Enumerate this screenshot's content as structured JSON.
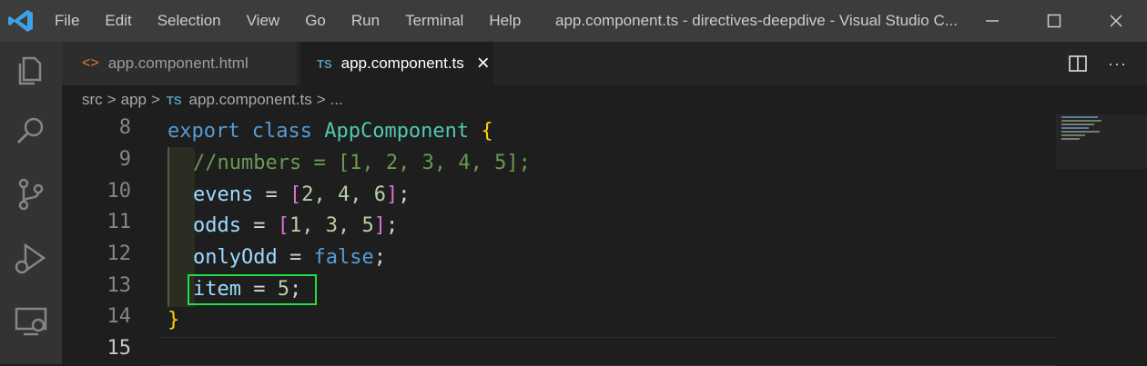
{
  "titlebar": {
    "menu": [
      "File",
      "Edit",
      "Selection",
      "View",
      "Go",
      "Run",
      "Terminal",
      "Help"
    ],
    "window_title": "app.component.ts - directives-deepdive - Visual Studio C..."
  },
  "tabs": [
    {
      "label": "app.component.html",
      "icon": "<>",
      "active": false
    },
    {
      "label": "app.component.ts",
      "icon": "TS",
      "active": true,
      "close": "×"
    }
  ],
  "tab_actions": {
    "more": "···"
  },
  "breadcrumb": {
    "items": [
      "src",
      "app",
      "app.component.ts",
      "..."
    ],
    "ts_badge": "TS",
    "separator": ">"
  },
  "editor": {
    "line_numbers": [
      "8",
      "9",
      "10",
      "11",
      "12",
      "13",
      "14",
      "15"
    ],
    "lines": {
      "l8": {
        "kw1": "export",
        "kw2": "class",
        "name": "AppComponent",
        "brace": "{"
      },
      "l9": {
        "comment": "//numbers = [1, 2, 3, 4, 5];"
      },
      "l10": {
        "var": "evens",
        "eq": " = ",
        "open": "[",
        "vals": "2, 4, 6",
        "close": "]",
        "semi": ";"
      },
      "l11": {
        "var": "odds",
        "eq": " = ",
        "open": "[",
        "vals": "1, 3, 5",
        "close": "]",
        "semi": ";"
      },
      "l12": {
        "var": "onlyOdd",
        "eq": " = ",
        "val": "false",
        "semi": ";"
      },
      "l13": {
        "var": "item",
        "eq": " = ",
        "val": "5",
        "semi": ";"
      },
      "l14": {
        "brace": "}"
      }
    }
  },
  "colors": {
    "accent_highlight": "#22dd44",
    "keyword": "#569cd6",
    "class": "#4ec9b0",
    "comment": "#6a9955"
  }
}
